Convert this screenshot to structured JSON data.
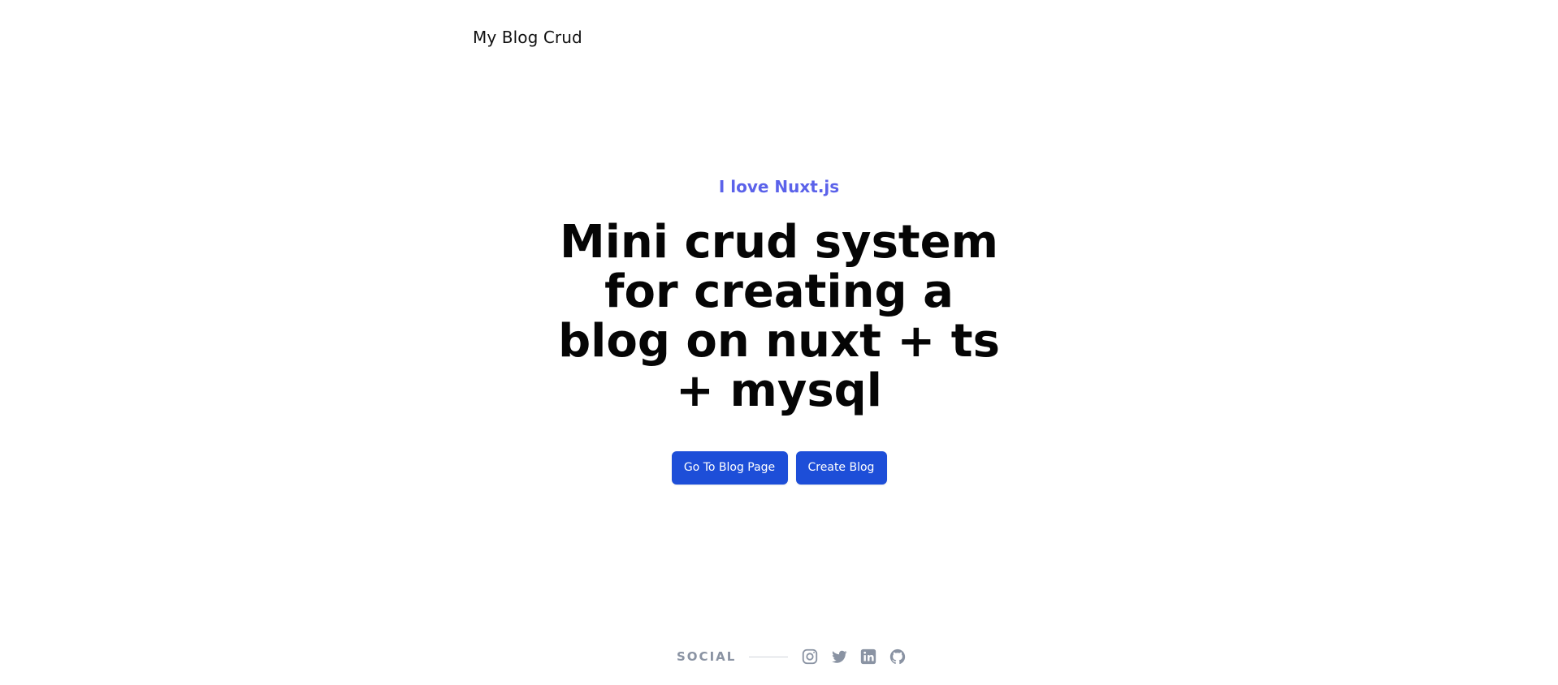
{
  "header": {
    "brand": "My Blog Crud"
  },
  "hero": {
    "eyebrow": "I love Nuxt.js",
    "title": "Mini crud system for creating a blog on nuxt + ts + mysql",
    "buttons": {
      "blog": "Go To Blog Page",
      "create": "Create Blog"
    }
  },
  "footer": {
    "social_label": "SOCIAL",
    "icons": [
      "instagram-icon",
      "twitter-icon",
      "linkedin-icon",
      "github-icon"
    ]
  },
  "colors": {
    "accent": "#5b62ea",
    "button": "#1d4ed8",
    "muted": "#8a93a3"
  }
}
